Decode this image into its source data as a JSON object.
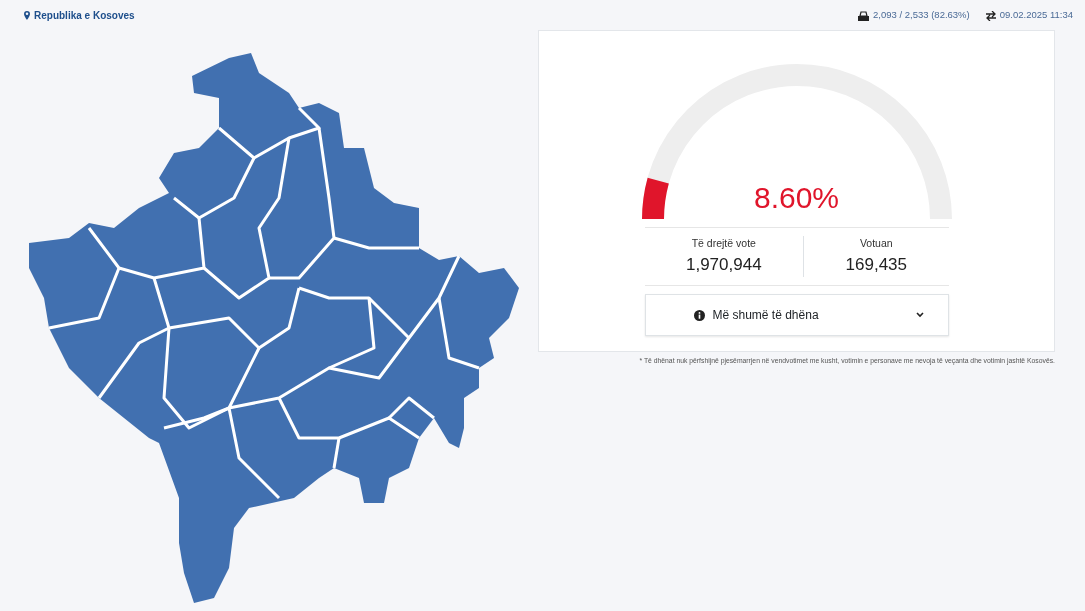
{
  "header": {
    "location": "Republika e Kosoves",
    "stations": "2,093 / 2,533 (82.63%)",
    "updated": "09.02.2025 11:34"
  },
  "turnout": {
    "level": 0.086,
    "reading": "8.60%"
  },
  "stats": [
    {
      "label": "Të drejtë vote",
      "value": "1,970,944"
    },
    {
      "label": "Votuan",
      "value": "169,435"
    }
  ],
  "more_button": {
    "label": "Më shumë të dhëna",
    "expanded": false
  },
  "footnote": "* Të dhënat nuk përfshijnë pjesëmarrjen në vendvotimet me kusht, votimin e personave me nevoja të veçanta dhe votimin jashtë Kosovës."
}
